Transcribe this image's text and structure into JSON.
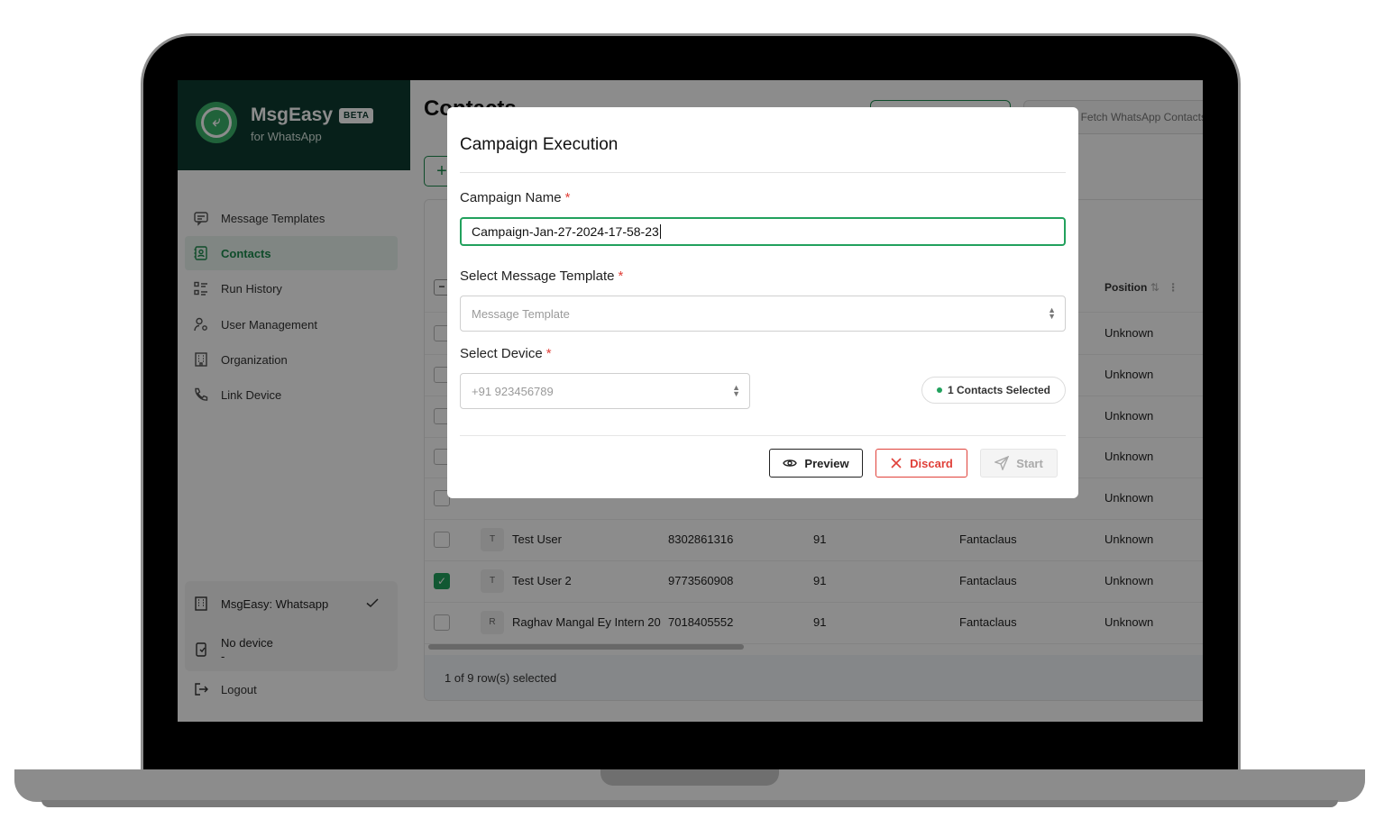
{
  "brand": {
    "name": "MsgEasy",
    "badge": "BETA",
    "subtitle": "for WhatsApp"
  },
  "sidebar": {
    "items": [
      {
        "label": "Message Templates",
        "icon": "message-icon",
        "active": false
      },
      {
        "label": "Contacts",
        "icon": "contacts-icon",
        "active": true
      },
      {
        "label": "Run History",
        "icon": "list-icon",
        "active": false
      },
      {
        "label": "User Management",
        "icon": "user-settings-icon",
        "active": false
      },
      {
        "label": "Organization",
        "icon": "building-icon",
        "active": false
      },
      {
        "label": "Link Device",
        "icon": "phone-icon",
        "active": false
      }
    ],
    "organization": {
      "name": "MsgEasy: Whatsapp"
    },
    "device": {
      "status": "No device",
      "detail": "-"
    },
    "logout": "Logout"
  },
  "main": {
    "title": "Contacts",
    "search_button": "Fetch WhatsApp Contacts",
    "add_button": "+",
    "table": {
      "column_position": "Position",
      "rows": [
        {
          "initial": "",
          "name": "",
          "phone": "",
          "code": "",
          "org": "",
          "position": "Unknown",
          "checked": false
        },
        {
          "initial": "",
          "name": "",
          "phone": "",
          "code": "",
          "org": "",
          "position": "Unknown",
          "checked": false
        },
        {
          "initial": "",
          "name": "",
          "phone": "",
          "code": "",
          "org": "",
          "position": "Unknown",
          "checked": false
        },
        {
          "initial": "",
          "name": "",
          "phone": "",
          "code": "",
          "org": "",
          "position": "Unknown",
          "checked": false
        },
        {
          "initial": "",
          "name": "",
          "phone": "",
          "code": "",
          "org": "",
          "position": "Unknown",
          "checked": false
        },
        {
          "initial": "T",
          "name": "Test User",
          "phone": "8302861316",
          "code": "91",
          "org": "Fantaclaus",
          "position": "Unknown",
          "checked": false
        },
        {
          "initial": "T",
          "name": "Test User 2",
          "phone": "9773560908",
          "code": "91",
          "org": "Fantaclaus",
          "position": "Unknown",
          "checked": true
        },
        {
          "initial": "R",
          "name": "Raghav Mangal Ey Intern 20",
          "phone": "7018405552",
          "code": "91",
          "org": "Fantaclaus",
          "position": "Unknown",
          "checked": false
        }
      ],
      "footer": "1 of 9 row(s) selected"
    }
  },
  "modal": {
    "title": "Campaign Execution",
    "campaign_name_label": "Campaign Name",
    "campaign_name_value": "Campaign-Jan-27-2024-17-58-23",
    "template_label": "Select Message Template",
    "template_placeholder": "Message Template",
    "device_label": "Select Device",
    "device_placeholder": "+91 923456789",
    "contacts_selected": "1 Contacts Selected",
    "required_mark": "*",
    "buttons": {
      "preview": "Preview",
      "discard": "Discard",
      "start": "Start"
    }
  },
  "colors": {
    "brand_dark": "#0d3b30",
    "accent": "#22a15d",
    "danger": "#e0413a"
  }
}
